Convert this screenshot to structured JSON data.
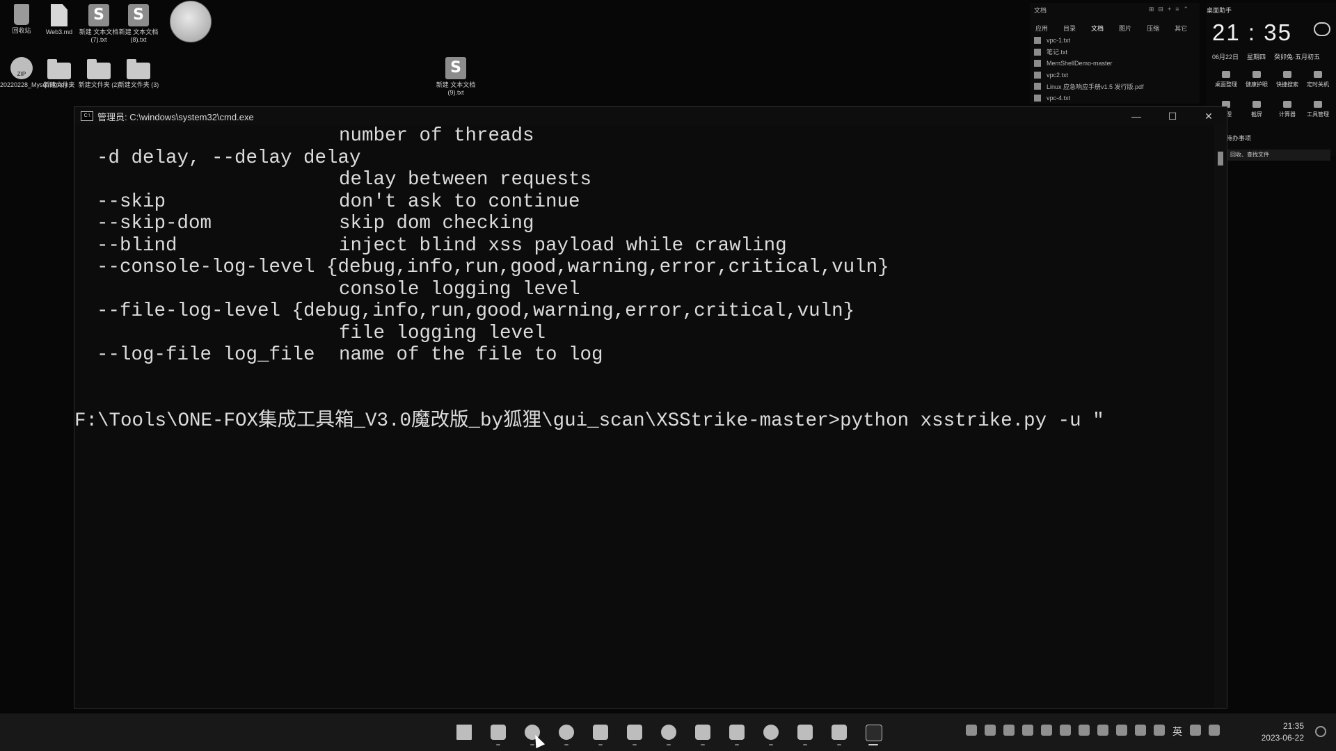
{
  "desktop": {
    "icons": [
      {
        "label": "回收站",
        "icon": "recycle-bin-icon"
      },
      {
        "label": "Web3.md",
        "icon": "markdown-file-icon"
      },
      {
        "label": "新建 文本文档 (7).txt",
        "icon": "sublime-text-file-icon"
      },
      {
        "label": "新建 文本文档 (8).txt",
        "icon": "sublime-text-file-icon"
      },
      {
        "label": "20220228_Mysql/Honey...",
        "icon": "zip-archive-icon"
      },
      {
        "label": "新建文件夹",
        "icon": "folder-icon"
      },
      {
        "label": "新建文件夹 (2)",
        "icon": "folder-icon"
      },
      {
        "label": "新建文件夹 (3)",
        "icon": "folder-icon"
      },
      {
        "label": "新建 文本文档 (9).txt",
        "icon": "sublime-text-file-icon"
      }
    ]
  },
  "file_widget": {
    "title": "文档",
    "tabs": [
      "应用",
      "目录",
      "文档",
      "图片",
      "压缩",
      "其它"
    ],
    "files": [
      "vpc-1.txt",
      "笔记.txt",
      "MemShellDemo-master",
      "vpc2.txt",
      "Linux 应急响应手册v1.5 发行版.pdf",
      "vpc-4.txt"
    ]
  },
  "clock_widget": {
    "title": "桌面助手",
    "time": "21 : 35",
    "date": "06月22日",
    "weekday": "星期四",
    "lunar": "癸卯兔·五月初五",
    "quick_actions": [
      "桌面整理",
      "健康护眼",
      "快捷搜索",
      "定时关机",
      "清理",
      "截屏",
      "计算器",
      "工具管理"
    ],
    "todo_title": "待办事项",
    "todo_item": "回收、查找文件"
  },
  "cmd_window": {
    "title": "管理员: C:\\windows\\system32\\cmd.exe",
    "lines": [
      {
        "opt": "",
        "desc": "number of threads"
      },
      {
        "opt": "-d delay, --delay delay",
        "desc": ""
      },
      {
        "opt": "",
        "desc": "delay between requests"
      },
      {
        "opt": "--skip",
        "desc": "don't ask to continue"
      },
      {
        "opt": "--skip-dom",
        "desc": "skip dom checking"
      },
      {
        "opt": "--blind",
        "desc": "inject blind xss payload while crawling"
      },
      {
        "opt": "--console-log-level {debug,info,run,good,warning,error,critical,vuln}",
        "desc": ""
      },
      {
        "opt": "",
        "desc": "console logging level"
      },
      {
        "opt": "--file-log-level {debug,info,run,good,warning,error,critical,vuln}",
        "desc": ""
      },
      {
        "opt": "",
        "desc": "file logging level"
      },
      {
        "opt": "--log-file log_file",
        "desc": "name of the file to log"
      }
    ],
    "prompt": "F:\\Tools\\ONE-FOX集成工具箱_V3.0魔改版_by狐狸\\gui_scan\\XSStrike-master>python xsstrike.py -u \""
  },
  "taskbar": {
    "apps": [
      "start-icon",
      "file-explorer-icon",
      "chrome-icon",
      "browser-icon",
      "notes-icon",
      "calculator-icon",
      "steam-icon",
      "feather-icon",
      "terminal-app-icon",
      "globe-icon",
      "editor-icon",
      "photos-icon",
      "cmd-icon"
    ],
    "language": "英",
    "time": "21:35",
    "date": "2023-06-22"
  }
}
